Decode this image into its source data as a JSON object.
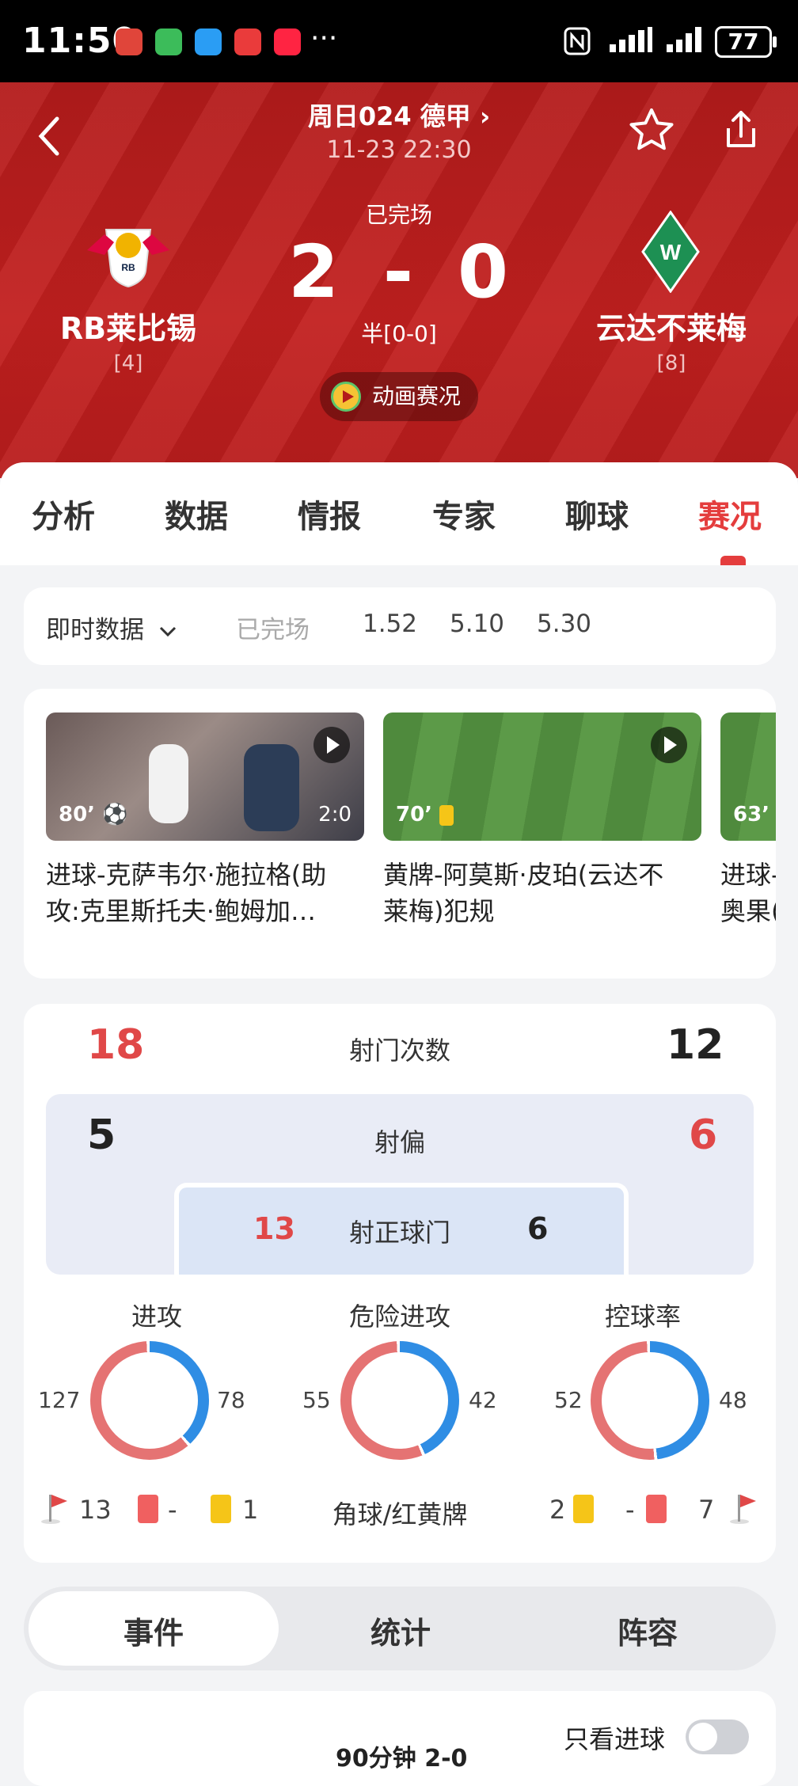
{
  "status_bar": {
    "time": "11:50",
    "battery": "77",
    "more": "···"
  },
  "header": {
    "league": "周日024 德甲 ›",
    "kickoff": "11-23 22:30",
    "status": "已完场",
    "score_home": "2",
    "score_sep": "-",
    "score_away": "0",
    "halftime": "半[0-0]",
    "animation_label": "动画赛况",
    "home_team": {
      "name": "RB莱比锡",
      "rank": "[4]"
    },
    "away_team": {
      "name": "云达不莱梅",
      "rank": "[8]"
    }
  },
  "tabs": [
    "分析",
    "数据",
    "情报",
    "专家",
    "聊球",
    "赛况"
  ],
  "active_tab": "赛况",
  "odds": {
    "label": "即时数据",
    "status": "已完场",
    "values": [
      "1.52",
      "5.10",
      "5.30"
    ]
  },
  "videos": [
    {
      "minute": "80’",
      "score": "2:0",
      "caption_l1": "进球-克萨韦尔·施拉格(助",
      "caption_l2": "攻:克里斯托夫·鲍姆加…"
    },
    {
      "minute": "70’",
      "caption_l1": "黄牌-阿莫斯·皮珀(云达不",
      "caption_l2": "莱梅)犯规"
    },
    {
      "minute": "63’",
      "caption_l1": "进球-",
      "caption_l2": "奥果("
    }
  ],
  "shots": {
    "total": {
      "label": "射门次数",
      "home": "18",
      "away": "12"
    },
    "off": {
      "label": "射偏",
      "home": "5",
      "away": "6"
    },
    "on": {
      "label": "射正球门",
      "home": "13",
      "away": "6"
    }
  },
  "donuts": [
    {
      "label": "进攻",
      "home": "127",
      "away": "78",
      "away_pct": 38
    },
    {
      "label": "危险进攻",
      "home": "55",
      "away": "42",
      "away_pct": 43
    },
    {
      "label": "控球率",
      "home": "52",
      "away": "48",
      "away_pct": 48
    }
  ],
  "cards": {
    "label": "角球/红黄牌",
    "home_corners": "13",
    "home_red": "-",
    "home_yellow": "1",
    "away_yellow": "2",
    "away_red": "-",
    "away_corners": "7"
  },
  "segments": [
    "事件",
    "统计",
    "阵容"
  ],
  "events_header": {
    "title": "90分钟 2-0",
    "filter": "只看进球"
  },
  "colors": {
    "brand_red": "#c2201f",
    "home": "#e57373",
    "away": "#2f8de4"
  }
}
